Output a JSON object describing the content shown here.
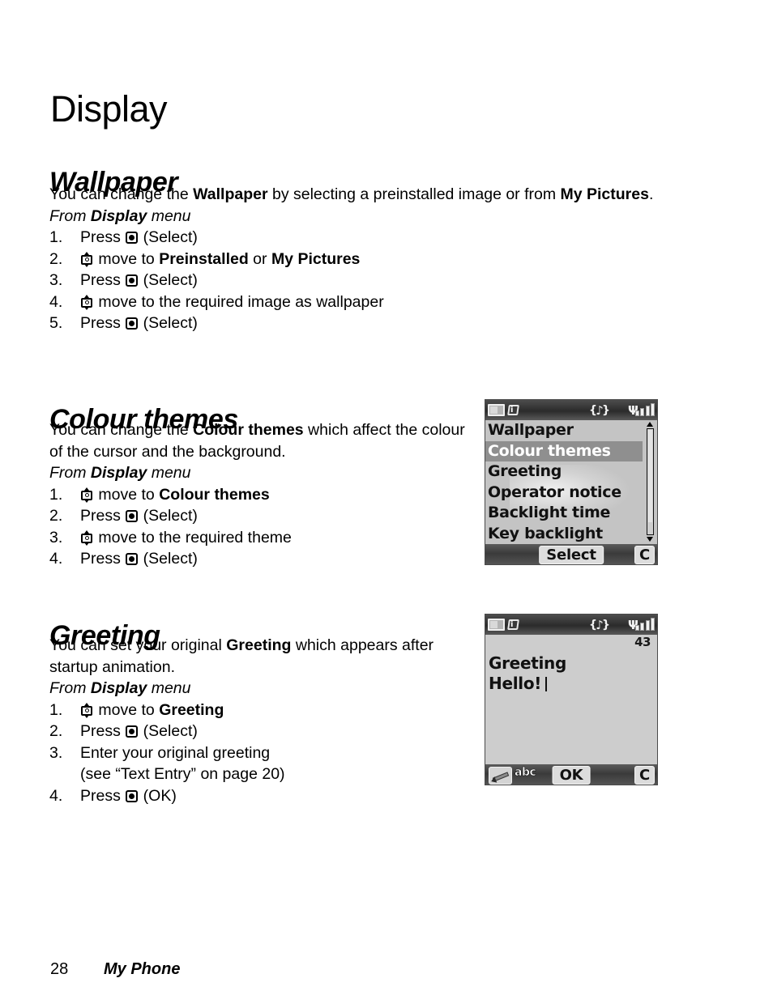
{
  "chapter": {
    "title": "Display"
  },
  "sections": {
    "wallpaper": {
      "heading": "Wallpaper",
      "intro_1": "You can change the ",
      "intro_b1": "Wallpaper",
      "intro_2": " by selecting a preinstalled image or from ",
      "intro_b2": "My Pictures",
      "intro_3": ".",
      "from_prefix": "From ",
      "from_bold": "Display",
      "from_suffix": " menu",
      "steps": [
        {
          "num": "1.",
          "icon": "select-key-icon",
          "pre": "Press ",
          "post": " (Select)"
        },
        {
          "num": "2.",
          "icon": "nav-key-icon",
          "pre": "",
          "post": " move to ",
          "bold": "Preinstalled",
          "mid": " or ",
          "bold2": "My Pictures"
        },
        {
          "num": "3.",
          "icon": "select-key-icon",
          "pre": "Press ",
          "post": " (Select)"
        },
        {
          "num": "4.",
          "icon": "nav-key-icon",
          "pre": "",
          "post": " move to the required image as wallpaper"
        },
        {
          "num": "5.",
          "icon": "select-key-icon",
          "pre": "Press ",
          "post": " (Select)"
        }
      ]
    },
    "colour_themes": {
      "heading": "Colour themes",
      "intro_1": "You can change the ",
      "intro_b1": "Colour themes",
      "intro_2": " which affect the colour of the cursor and the background.",
      "from_prefix": "From ",
      "from_bold": "Display",
      "from_suffix": " menu",
      "steps": [
        {
          "num": "1.",
          "icon": "nav-key-icon",
          "pre": "",
          "post": " move to ",
          "bold": "Colour themes"
        },
        {
          "num": "2.",
          "icon": "select-key-icon",
          "pre": "Press ",
          "post": " (Select)"
        },
        {
          "num": "3.",
          "icon": "nav-key-icon",
          "pre": "",
          "post": " move to the required theme"
        },
        {
          "num": "4.",
          "icon": "select-key-icon",
          "pre": "Press ",
          "post": " (Select)"
        }
      ]
    },
    "greeting": {
      "heading": "Greeting",
      "intro_1": "You can set your original ",
      "intro_b1": "Greeting",
      "intro_2": " which appears after startup animation.",
      "from_prefix": "From ",
      "from_bold": "Display",
      "from_suffix": " menu",
      "steps": [
        {
          "num": "1.",
          "icon": "nav-key-icon",
          "pre": "",
          "post": " move to ",
          "bold": "Greeting"
        },
        {
          "num": "2.",
          "icon": "select-key-icon",
          "pre": "Press ",
          "post": " (Select)"
        },
        {
          "num": "3.",
          "icon": "none",
          "pre": "Enter your original greeting",
          "post": "",
          "sub": "(see “Text Entry” on page 20)"
        },
        {
          "num": "4.",
          "icon": "select-key-icon",
          "pre": "Press ",
          "post": " (OK)"
        }
      ]
    }
  },
  "phone_menu_screenshot": {
    "status_icons": [
      "battery-icon",
      "info-icon",
      "music-icon",
      "signal-icon"
    ],
    "info_badge": "i",
    "items": [
      "Wallpaper",
      "Colour themes",
      "Greeting",
      "Operator notice",
      "Backlight time",
      "Key backlight"
    ],
    "selected_index": 1,
    "softkeys": {
      "center": "Select",
      "right": "C"
    }
  },
  "phone_greeting_screenshot": {
    "status_icons": [
      "battery-icon",
      "info-icon",
      "music-icon",
      "signal-icon"
    ],
    "info_badge": "i",
    "char_counter": "43",
    "line1": "Greeting",
    "line2": "Hello!",
    "softkeys": {
      "left_icon": "pencil-icon",
      "mode": "abc",
      "center": "OK",
      "right": "C"
    }
  },
  "footer": {
    "page_number": "28",
    "book_section": "My Phone"
  }
}
